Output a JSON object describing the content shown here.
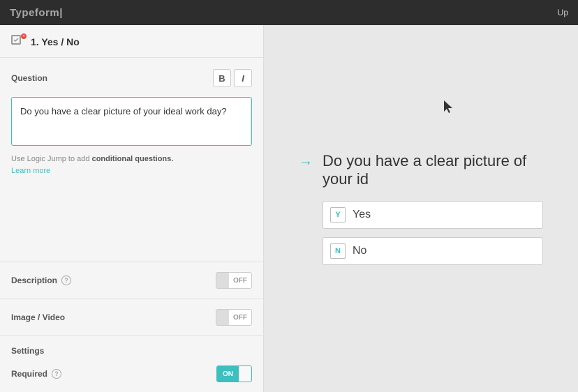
{
  "topBar": {
    "logo": "Typeform",
    "logoBar": "|",
    "rightText": "Up"
  },
  "leftPanel": {
    "questionHeader": {
      "number": "1.",
      "title": "Yes / No"
    },
    "questionSection": {
      "label": "Question",
      "boldButton": "B",
      "italicButton": "I",
      "textareaValue": "Do you have a clear picture of your ideal work day?",
      "logicText": "Use Logic Jump to add",
      "conditionalText": "conditional questions.",
      "learnMore": "Learn more"
    },
    "descriptionRow": {
      "label": "Description",
      "toggleState": "OFF"
    },
    "imageVideoRow": {
      "label": "Image / Video",
      "toggleState": "OFF"
    },
    "settingsSection": {
      "title": "Settings",
      "requiredRow": {
        "label": "Required",
        "helpTooltip": "?",
        "toggleState": "ON"
      }
    }
  },
  "rightPanel": {
    "arrow": "→",
    "questionText": "Do you have a clear picture of your id",
    "options": [
      {
        "key": "Y",
        "label": "Yes"
      },
      {
        "key": "N",
        "label": "No"
      }
    ]
  }
}
